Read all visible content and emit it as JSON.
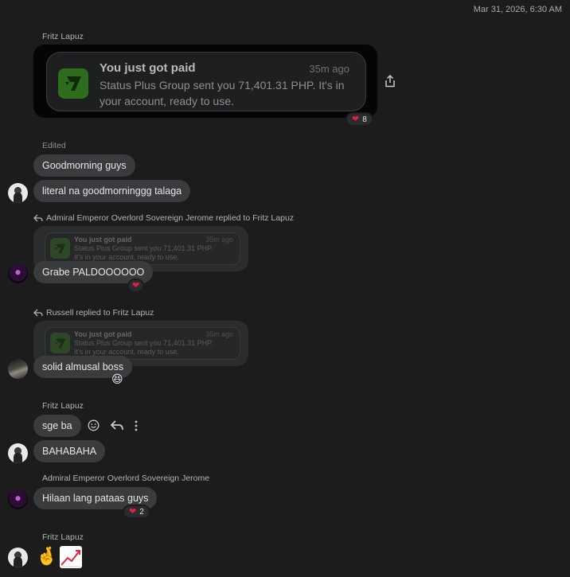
{
  "timestamp": "Mar 31, 2026, 6:30 AM",
  "payment": {
    "sender": "Fritz Lapuz",
    "title": "You just got paid",
    "time": "35m ago",
    "body": "Status Plus Group sent you 71,401.31 PHP. It's in your account, ready to use.",
    "reaction_count": "8",
    "reaction_icon": "heart-icon"
  },
  "group1": {
    "edited": "Edited",
    "msg1": "Goodmorning guys",
    "msg2": "literal na goodmorninggg talaga"
  },
  "reply1": {
    "note": "Admiral Emperor Overlord Sovereign Jerome replied to Fritz Lapuz",
    "quote_title": "You just got paid",
    "quote_time": "35m ago",
    "quote_line1": "Status Plus Group sent you 71,401.31 PHP.",
    "quote_line2": "It's in your account, ready to use.",
    "message": "Grabe PALDOOOOOO"
  },
  "reply2": {
    "note": "Russell replied to Fritz Lapuz",
    "quote_title": "You just got paid",
    "quote_time": "35m ago",
    "quote_line1": "Status Plus Group sent you 71,401.31 PHP.",
    "quote_line2": "It's in your account, ready to use.",
    "message": "solid almusal boss",
    "reaction_emoji": "😆"
  },
  "group2": {
    "sender": "Fritz Lapuz",
    "msg1": "sge ba",
    "msg2": "BAHABAHA",
    "hover_actions": [
      "smiley-icon",
      "reply-icon",
      "more-icon"
    ]
  },
  "group3": {
    "sender": "Admiral Emperor Overlord Sovereign Jerome",
    "message": "Hilaan lang pataas guys",
    "reaction_count": "2"
  },
  "group4": {
    "sender": "Fritz Lapuz",
    "emoji1": "🤞",
    "emoji2_icon": "chart-increasing-icon"
  },
  "colors": {
    "background": "#1c1c1c",
    "bubble": "#3a3b3c",
    "heart": "#e41e3f",
    "wise_green": "#2f6d1e"
  }
}
